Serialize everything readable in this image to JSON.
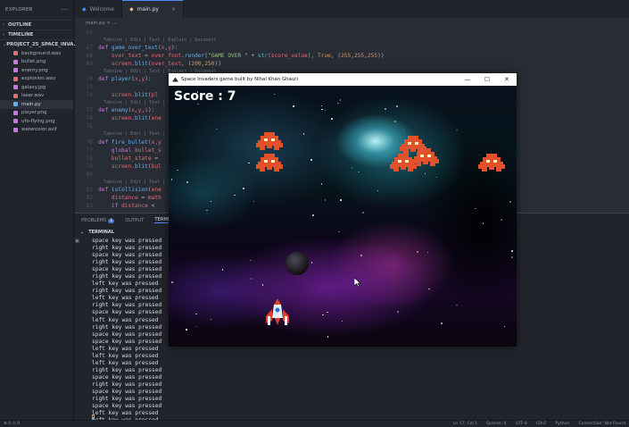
{
  "sidebar": {
    "title": "EXPLORER",
    "sections": {
      "outline": "OUTLINE",
      "timeline": "TIMELINE",
      "project": "PROJECT_25_SPACE_INVA..."
    },
    "files": [
      {
        "name": "background.wav",
        "color": "#e06c75"
      },
      {
        "name": "bullet.png",
        "color": "#c678dd"
      },
      {
        "name": "enemy.png",
        "color": "#c678dd"
      },
      {
        "name": "explosion.wav",
        "color": "#e06c75"
      },
      {
        "name": "galaxy.jpg",
        "color": "#c678dd"
      },
      {
        "name": "laser.wav",
        "color": "#e06c75"
      },
      {
        "name": "main.py",
        "color": "#61afef"
      },
      {
        "name": "player.png",
        "color": "#c678dd"
      },
      {
        "name": "ufo-flying.png",
        "color": "#c678dd"
      },
      {
        "name": "watercolor.avif",
        "color": "#c678dd"
      }
    ]
  },
  "tabs": [
    {
      "label": "Welcome"
    },
    {
      "label": "main.py"
    }
  ],
  "breadcrumb": "main.py > ...",
  "code": {
    "line_66": "66",
    "lens_1": "Tabnine | Edit | Test | Explain | Document",
    "line_67": "67",
    "line_68": "68",
    "line_69": "69",
    "lens_2": "Tabnine | Edit | Test | Explain | Document",
    "line_70": "70",
    "line_71": "71",
    "line_72": "72",
    "line_73": "73",
    "lens_3": "Tabnine | Edit | Test | Explain | Document",
    "line_74": "74",
    "lens_4": "Tabnine | Edit | Test | Explain | Document",
    "line_75": "75",
    "line_76": "76",
    "line_77": "77",
    "line_78": "78",
    "line_79": "79",
    "line_80": "80",
    "lens_5": "Tabnine | Edit | Test | Explain | Document",
    "line_81": "81",
    "line_82": "82",
    "line_83": "83"
  },
  "panel": {
    "tabs": [
      "PROBLEMS",
      "OUTPUT",
      "TERMINAL"
    ],
    "problems_badge": "1",
    "terminal_header": "TERMINAL",
    "lines": [
      "space key was pressed",
      "right key was pressed",
      "space key was pressed",
      "right key was pressed",
      "space key was pressed",
      "right key was pressed",
      "left key was pressed",
      "right key was pressed",
      "left key was pressed",
      "right key was pressed",
      "space key was pressed",
      "left key was pressed",
      "right key was pressed",
      "space key was pressed",
      "space key was pressed",
      "left key was pressed",
      "left key was pressed",
      "left key was pressed",
      "right key was pressed",
      "space key was pressed",
      "right key was pressed",
      "space key was pressed",
      "right key was pressed",
      "space key was pressed",
      "left key was pressed",
      "left key was pressed",
      "space key was pressed",
      "right key was pressed",
      "right key was pressed"
    ]
  },
  "status": {
    "left": "⊗ 0  ⚠ 0",
    "right": [
      "Ln 17, Col 1",
      "Spaces: 4",
      "UTF-8",
      "CRLF",
      "Python",
      "Connection: Not Found"
    ]
  },
  "game": {
    "window_title": "Space Invaders game built by Nihal Khan Ghauri",
    "score_text": "Score : 7",
    "colors": {
      "enemy": "#e2512a",
      "enemy_eye": "#fff3c0",
      "player_body": "#e9eef5",
      "player_accent": "#e33d2c"
    },
    "icons": [
      "enemy-icon",
      "player-ship-icon"
    ]
  }
}
